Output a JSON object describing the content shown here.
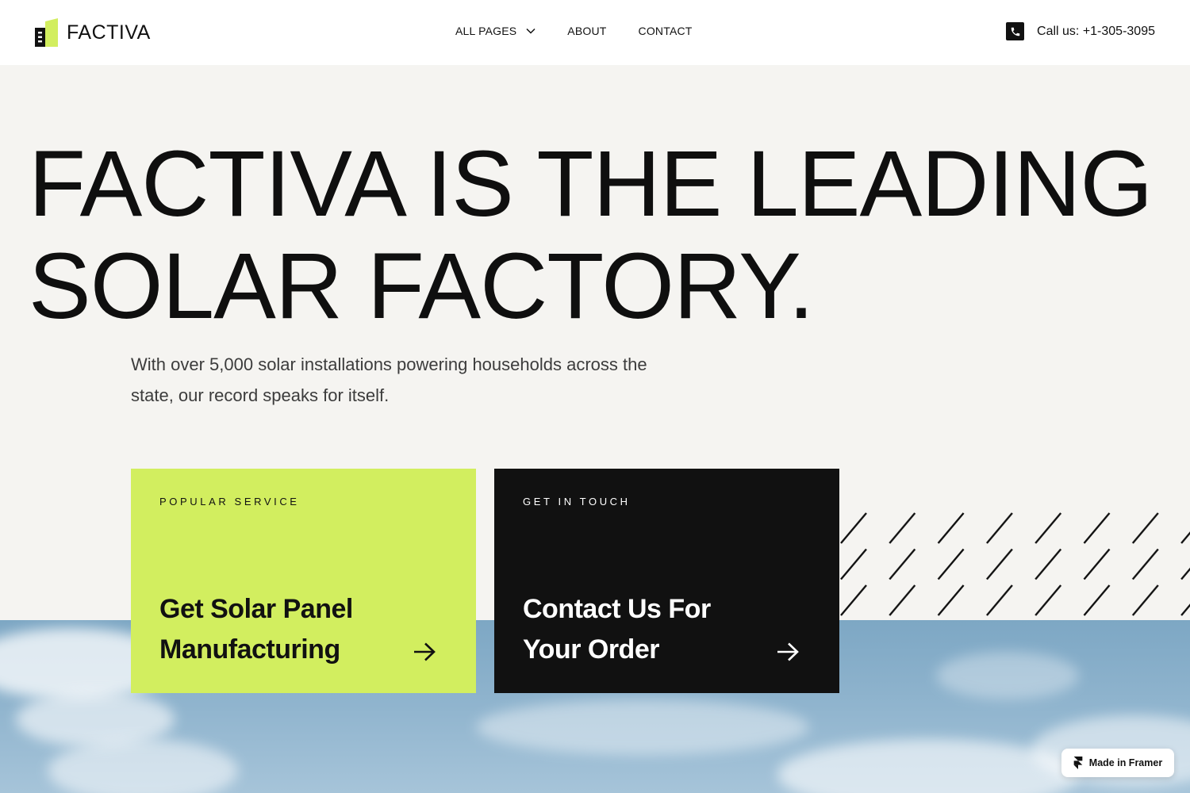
{
  "header": {
    "logo_text": "FACTIVA",
    "nav": {
      "all_pages": "ALL PAGES",
      "about": "ABOUT",
      "contact": "CONTACT"
    },
    "phone_label": "Call us: +1-305-3095",
    "icons": {
      "phone": "phone-icon",
      "dropdown": "chevron-down-icon",
      "logo": "building-logo-icon"
    }
  },
  "hero": {
    "headline_line1": "FACTIVA IS THE LEADING",
    "headline_line2": "SOLAR FACTORY.",
    "subtext": "With over 5,000 solar installations powering households across the state, our record speaks for itself."
  },
  "cards": {
    "service": {
      "label": "POPULAR SERVICE",
      "title_line1": "Get Solar Panel",
      "title_line2": "Manufacturing",
      "icon": "arrow-right-icon"
    },
    "contact": {
      "label": "GET IN TOUCH",
      "title_line1": "Contact Us For",
      "title_line2": "Your Order",
      "icon": "arrow-right-icon"
    }
  },
  "badge": {
    "label": "Made in Framer",
    "icon": "framer-icon"
  },
  "colors": {
    "accent_green": "#d2ee5f",
    "dark": "#111111",
    "background": "#f5f4f1",
    "header_bg": "#ffffff",
    "sky": "#8eb3cd"
  }
}
